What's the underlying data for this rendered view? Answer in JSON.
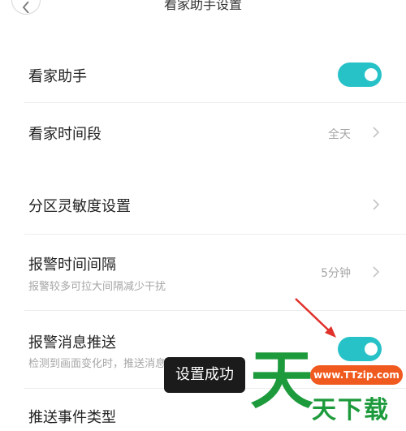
{
  "header": {
    "title": "看家助手设置"
  },
  "rows": [
    {
      "label": "看家助手",
      "toggle_on": true
    },
    {
      "label": "看家时间段",
      "value": "全天"
    },
    {
      "label": "分区灵敏度设置"
    },
    {
      "label": "报警时间间隔",
      "subtitle": "报警较多可拉大间隔减少干扰",
      "value": "5分钟"
    },
    {
      "label": "报警消息推送",
      "subtitle": "检测到画面变化时，推送消息给手机",
      "toggle_on": true
    },
    {
      "label": "推送事件类型"
    }
  ],
  "toast": {
    "text": "设置成功"
  },
  "watermark": {
    "big": "天",
    "url": "www.TTzip.com",
    "small": "天下载"
  },
  "colors": {
    "accent": "#27c2c7",
    "arrow": "#e0312a",
    "brand_green": "#1d9a3c",
    "brand_orange": "#f05a1e"
  }
}
